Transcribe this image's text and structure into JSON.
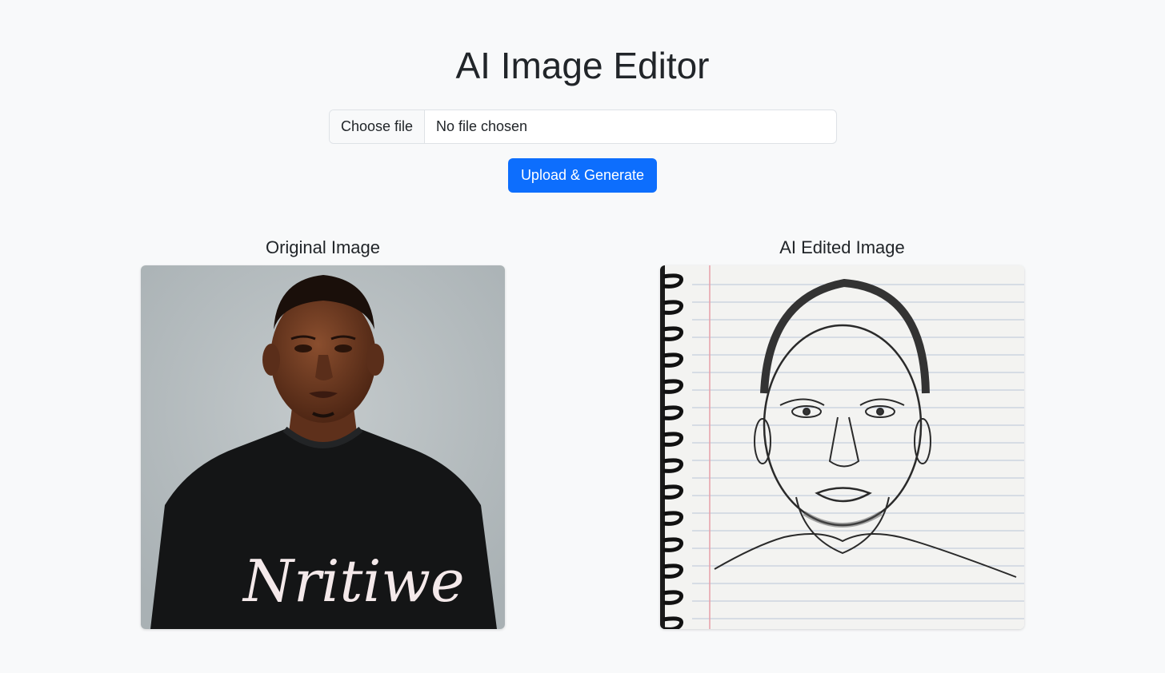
{
  "page": {
    "title": "AI Image Editor"
  },
  "upload_form": {
    "choose_file_label": "Choose file",
    "file_status": "No file chosen",
    "submit_label": "Upload & Generate"
  },
  "original": {
    "label": "Original Image",
    "shirt_text": "Nritiwe"
  },
  "edited": {
    "label": "AI Edited Image"
  },
  "colors": {
    "background": "#f8f9fa",
    "primary": "#0d6efd",
    "photo_backdrop": "#b9c0c2",
    "shirt": "#141516",
    "skin": "#6b3a22",
    "paper": "#f3f3f1",
    "ruled_line": "#b8c4d8",
    "margin_line": "#e8a0a8"
  }
}
